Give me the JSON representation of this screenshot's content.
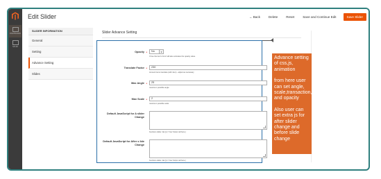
{
  "rail": {
    "items": [
      {
        "label": "DASHBOARD"
      },
      {
        "label": "SALES"
      }
    ]
  },
  "header": {
    "title": "Edit Slider",
    "actions": {
      "back": "Back",
      "delete": "Delete",
      "reset": "Reset",
      "save_continue": "Save and Continue Edit",
      "save": "Save Slider"
    }
  },
  "sidebar": {
    "heading": "SLIDER INFORMATION",
    "items": [
      "General",
      "Setting",
      "Advance Setting",
      "Slides"
    ],
    "active": "Advance Setting"
  },
  "content": {
    "section_title": "Slider Advance Setting",
    "fields": {
      "opacity": {
        "label": "Opacity",
        "value": "No",
        "note": "If true the item's fronz will also animates the opacity value."
      },
      "translate": {
        "label": "Translate Factor",
        "value": "230",
        "note": "Amount items translate (with 2em) - adjust as necessary"
      },
      "angle": {
        "label": "Max Angle",
        "value": "25",
        "note": "maximum possible angle"
      },
      "scale": {
        "label": "Max Scale",
        "value": "2",
        "note": "maximum possible scale"
      },
      "js_change": {
        "label": "Default JavaScript for A slider Change",
        "note": "functions slider. fak (){ // Your Script call here }"
      },
      "js_after": {
        "label": "Default JavaScript for After s lide Change",
        "note": "functions slider. fak (){ // Your Script call here }"
      }
    }
  },
  "callout": {
    "paragraph1": "Advance setting of css,js, animation",
    "paragraph2": "from here user can set angle, scale,transaction,factor and opacity",
    "paragraph3": "Also user can set extra js for after slider change and before slide change"
  },
  "colors": {
    "accent": "#eb5202",
    "frame": "#2f7f7e",
    "panel_outline": "#2a6fa8",
    "callout_bg": "#dd6a2a",
    "rail_bg": "#3b3b3b"
  }
}
